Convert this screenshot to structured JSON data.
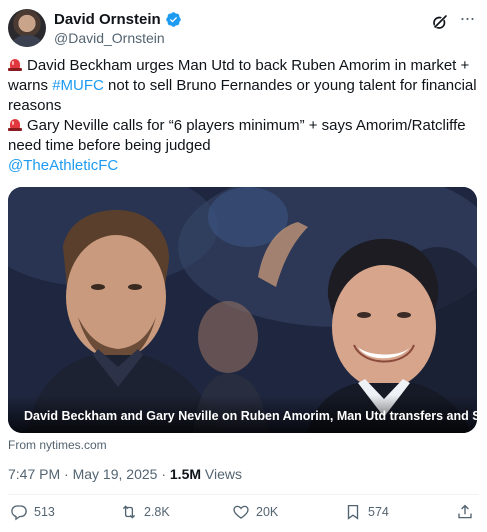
{
  "author": {
    "name": "David Ornstein",
    "handle": "@David_Ornstein",
    "verified": true
  },
  "tweet": {
    "lines": [
      {
        "pre": "David Beckham urges Man Utd to back Ruben Amorim in market +"
      },
      {
        "pre": "warns ",
        "hashtag": "#MUFC",
        "post": " not to sell Bruno Fernandes or young talent for financial"
      },
      {
        "pre": "reasons"
      },
      {
        "pre": "Gary Neville calls for “6 players minimum” + says Amorim/Ratcliffe"
      },
      {
        "pre": "need time before being judged"
      },
      {
        "mention": "@TheAthleticFC"
      }
    ]
  },
  "media": {
    "caption": "David Beckham and Gary Neville on Ruben Amorim, Man Utd transfers and Sir Jim Rat..."
  },
  "source": "From nytimes.com",
  "meta": {
    "time": "7:47 PM",
    "separator": " · ",
    "date": "May 19, 2025",
    "views_count": "1.5M",
    "views_label": " Views"
  },
  "actions": {
    "replies": "513",
    "reposts": "2.8K",
    "likes": "20K",
    "bookmarks": "574"
  },
  "colors": {
    "accent": "#1d9bf0",
    "text": "#0f1419",
    "secondary": "#536471"
  },
  "icons": {
    "verified": "verified-badge-icon",
    "grok": "grok-icon",
    "more": "more-icon",
    "siren": "police-light-emoji",
    "reply": "reply-icon",
    "repost": "repost-icon",
    "like": "heart-icon",
    "bookmark": "bookmark-icon",
    "share": "share-icon"
  }
}
